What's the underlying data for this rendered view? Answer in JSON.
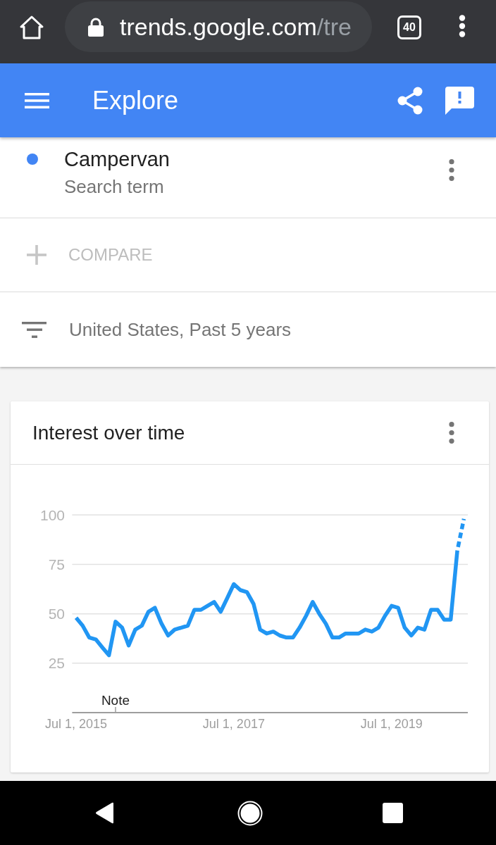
{
  "browser_bar": {
    "url": {
      "host": "trends.google.com",
      "path": "/tre"
    },
    "tab_count": "40"
  },
  "app_bar": {
    "title": "Explore"
  },
  "search_terms": [
    {
      "term": "Campervan",
      "term_type": "Search term",
      "color": "#4285f4"
    }
  ],
  "compare": {
    "label": "COMPARE"
  },
  "filters": {
    "summary": "United States, Past 5 years"
  },
  "cards": [
    {
      "title": "Interest over time",
      "chart_data": {
        "type": "line",
        "categories": [
          "Jul 1, 2015",
          null,
          null,
          null,
          null,
          null,
          null,
          null,
          null,
          null,
          null,
          null,
          null,
          null,
          null,
          null,
          null,
          null,
          null,
          null,
          null,
          null,
          null,
          null,
          "Jul 1, 2017",
          null,
          null,
          null,
          null,
          null,
          null,
          null,
          null,
          null,
          null,
          null,
          null,
          null,
          null,
          null,
          null,
          null,
          null,
          null,
          null,
          null,
          null,
          null,
          "Jul 1, 2019",
          null,
          null,
          null,
          null,
          null,
          null,
          null,
          null,
          null,
          null,
          null
        ],
        "series": [
          {
            "color": "#2196f3",
            "line_style": "dashed_end",
            "values": [
              48,
              44,
              38,
              37,
              33,
              29,
              46,
              43,
              34,
              42,
              44,
              51,
              53,
              45,
              39,
              42,
              43,
              44,
              52,
              52,
              54,
              56,
              51,
              58,
              65,
              62,
              61,
              55,
              42,
              40,
              41,
              39,
              38,
              38,
              43,
              49,
              56,
              50,
              45,
              38,
              38,
              40,
              40,
              40,
              42,
              41,
              43,
              49,
              54,
              53,
              43,
              39,
              43,
              42,
              52,
              52,
              47,
              47,
              82,
              98
            ]
          }
        ],
        "ylim": [
          0,
          100
        ],
        "yticks": [
          25,
          50,
          75,
          100
        ],
        "grid": true,
        "annotations": [
          "Note"
        ]
      }
    }
  ]
}
